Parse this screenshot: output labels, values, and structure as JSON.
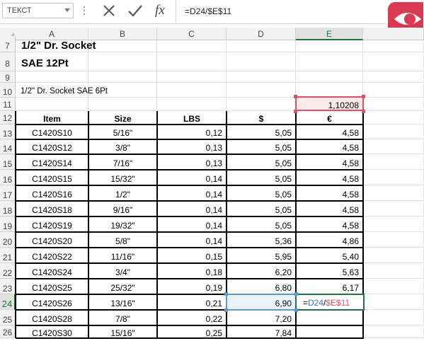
{
  "formula_bar": {
    "name_box": "ТЕКСТ",
    "cancel_icon": "cross-icon",
    "enter_icon": "checkmark-icon",
    "function_label": "fx",
    "formula": "=D24/$E$11"
  },
  "brand": {
    "icon": "eye-icon",
    "color": "#d83a54"
  },
  "columns": [
    "A",
    "B",
    "C",
    "D",
    "E"
  ],
  "selected_column": "E",
  "rows": [
    "7",
    "8",
    "9",
    "10",
    "11",
    "12",
    "13",
    "14",
    "15",
    "16",
    "17",
    "18",
    "19",
    "20",
    "21",
    "22",
    "23",
    "24",
    "25",
    "26"
  ],
  "selected_row": "24",
  "title1": "1/2\" Dr. Socket",
  "title2": "SAE 12Pt",
  "subtitle": "1/2\" Dr. Socket SAE 6Pt",
  "rate": "1,10208",
  "headers": {
    "item": "Item",
    "size": "Size",
    "lbs": "LBS",
    "usd": "$",
    "eur": "€"
  },
  "table": [
    {
      "item": "C1420S10",
      "size": "5/16\"",
      "lbs": "0,12",
      "usd": "5,05",
      "eur": "4,58"
    },
    {
      "item": "C1420S12",
      "size": "3/8\"",
      "lbs": "0,13",
      "usd": "5,05",
      "eur": "4,58"
    },
    {
      "item": "C1420S14",
      "size": "7/16\"",
      "lbs": "0,13",
      "usd": "5,05",
      "eur": "4,58"
    },
    {
      "item": "C1420S15",
      "size": "15/32\"",
      "lbs": "0,14",
      "usd": "5,05",
      "eur": "4,58"
    },
    {
      "item": "C1420S16",
      "size": "1/2\"",
      "lbs": "0,14",
      "usd": "5,05",
      "eur": "4,58"
    },
    {
      "item": "C1420S18",
      "size": "9/16\"",
      "lbs": "0,14",
      "usd": "5,05",
      "eur": "4,58"
    },
    {
      "item": "C1420S19",
      "size": "19/32\"",
      "lbs": "0,14",
      "usd": "5,05",
      "eur": "4,58"
    },
    {
      "item": "C1420S20",
      "size": "5/8\"",
      "lbs": "0,14",
      "usd": "5,36",
      "eur": "4,86"
    },
    {
      "item": "C1420S22",
      "size": "11/16\"",
      "lbs": "0,15",
      "usd": "5,95",
      "eur": "5,40"
    },
    {
      "item": "C1420S24",
      "size": "3/4\"",
      "lbs": "0,18",
      "usd": "6,20",
      "eur": "5,63"
    },
    {
      "item": "C1420S25",
      "size": "25/32\"",
      "lbs": "0,19",
      "usd": "6,80",
      "eur": "6,17"
    },
    {
      "item": "C1420S26",
      "size": "13/16\"",
      "lbs": "0,21",
      "usd": "6,90",
      "eur": ""
    },
    {
      "item": "C1420S28",
      "size": "7/8\"",
      "lbs": "0,22",
      "usd": "7,20",
      "eur": ""
    },
    {
      "item": "C1420S30",
      "size": "15/16\"",
      "lbs": "0,25",
      "usd": "7,84",
      "eur": ""
    }
  ],
  "edit_cell": {
    "eq": "=",
    "ref1": "D24",
    "slash": "/",
    "ref2": "$E$11",
    "ref1_color": "#4472c4",
    "ref2_color": "#e05060"
  }
}
